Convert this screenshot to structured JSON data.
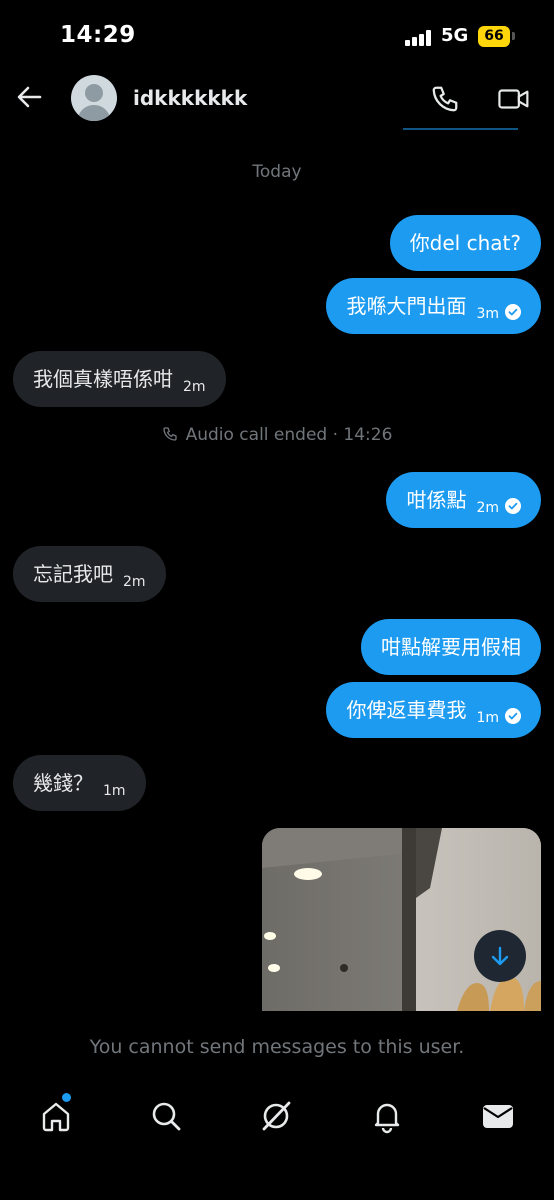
{
  "status_bar": {
    "time": "14:29",
    "network": "5G",
    "battery": "66"
  },
  "header": {
    "username": "idkkkkkkk"
  },
  "conversation": {
    "day_label": "Today",
    "system_message": "Audio call ended · 14:26",
    "messages": [
      {
        "direction": "out",
        "text": "你del chat?",
        "time": ""
      },
      {
        "direction": "out",
        "text": "我喺大門出面",
        "time": "3m"
      },
      {
        "direction": "in",
        "text": "我個真樣唔係咁",
        "time": "2m"
      },
      {
        "direction": "out",
        "text": "咁係點",
        "time": "2m"
      },
      {
        "direction": "in",
        "text": "忘記我吧",
        "time": "2m"
      },
      {
        "direction": "out",
        "text": "咁點解要用假相",
        "time": ""
      },
      {
        "direction": "out",
        "text": "你俾返車費我",
        "time": "1m"
      },
      {
        "direction": "in",
        "text": "幾錢？",
        "time": "1m"
      }
    ]
  },
  "footer_notice": "You cannot send messages to this user.",
  "nav": {
    "items": [
      "home-icon",
      "search-icon",
      "grok-icon",
      "notifications-icon",
      "messages-icon"
    ]
  },
  "colors": {
    "accent": "#1d9bf0",
    "incoming_bubble": "#202327",
    "background": "#000000"
  }
}
